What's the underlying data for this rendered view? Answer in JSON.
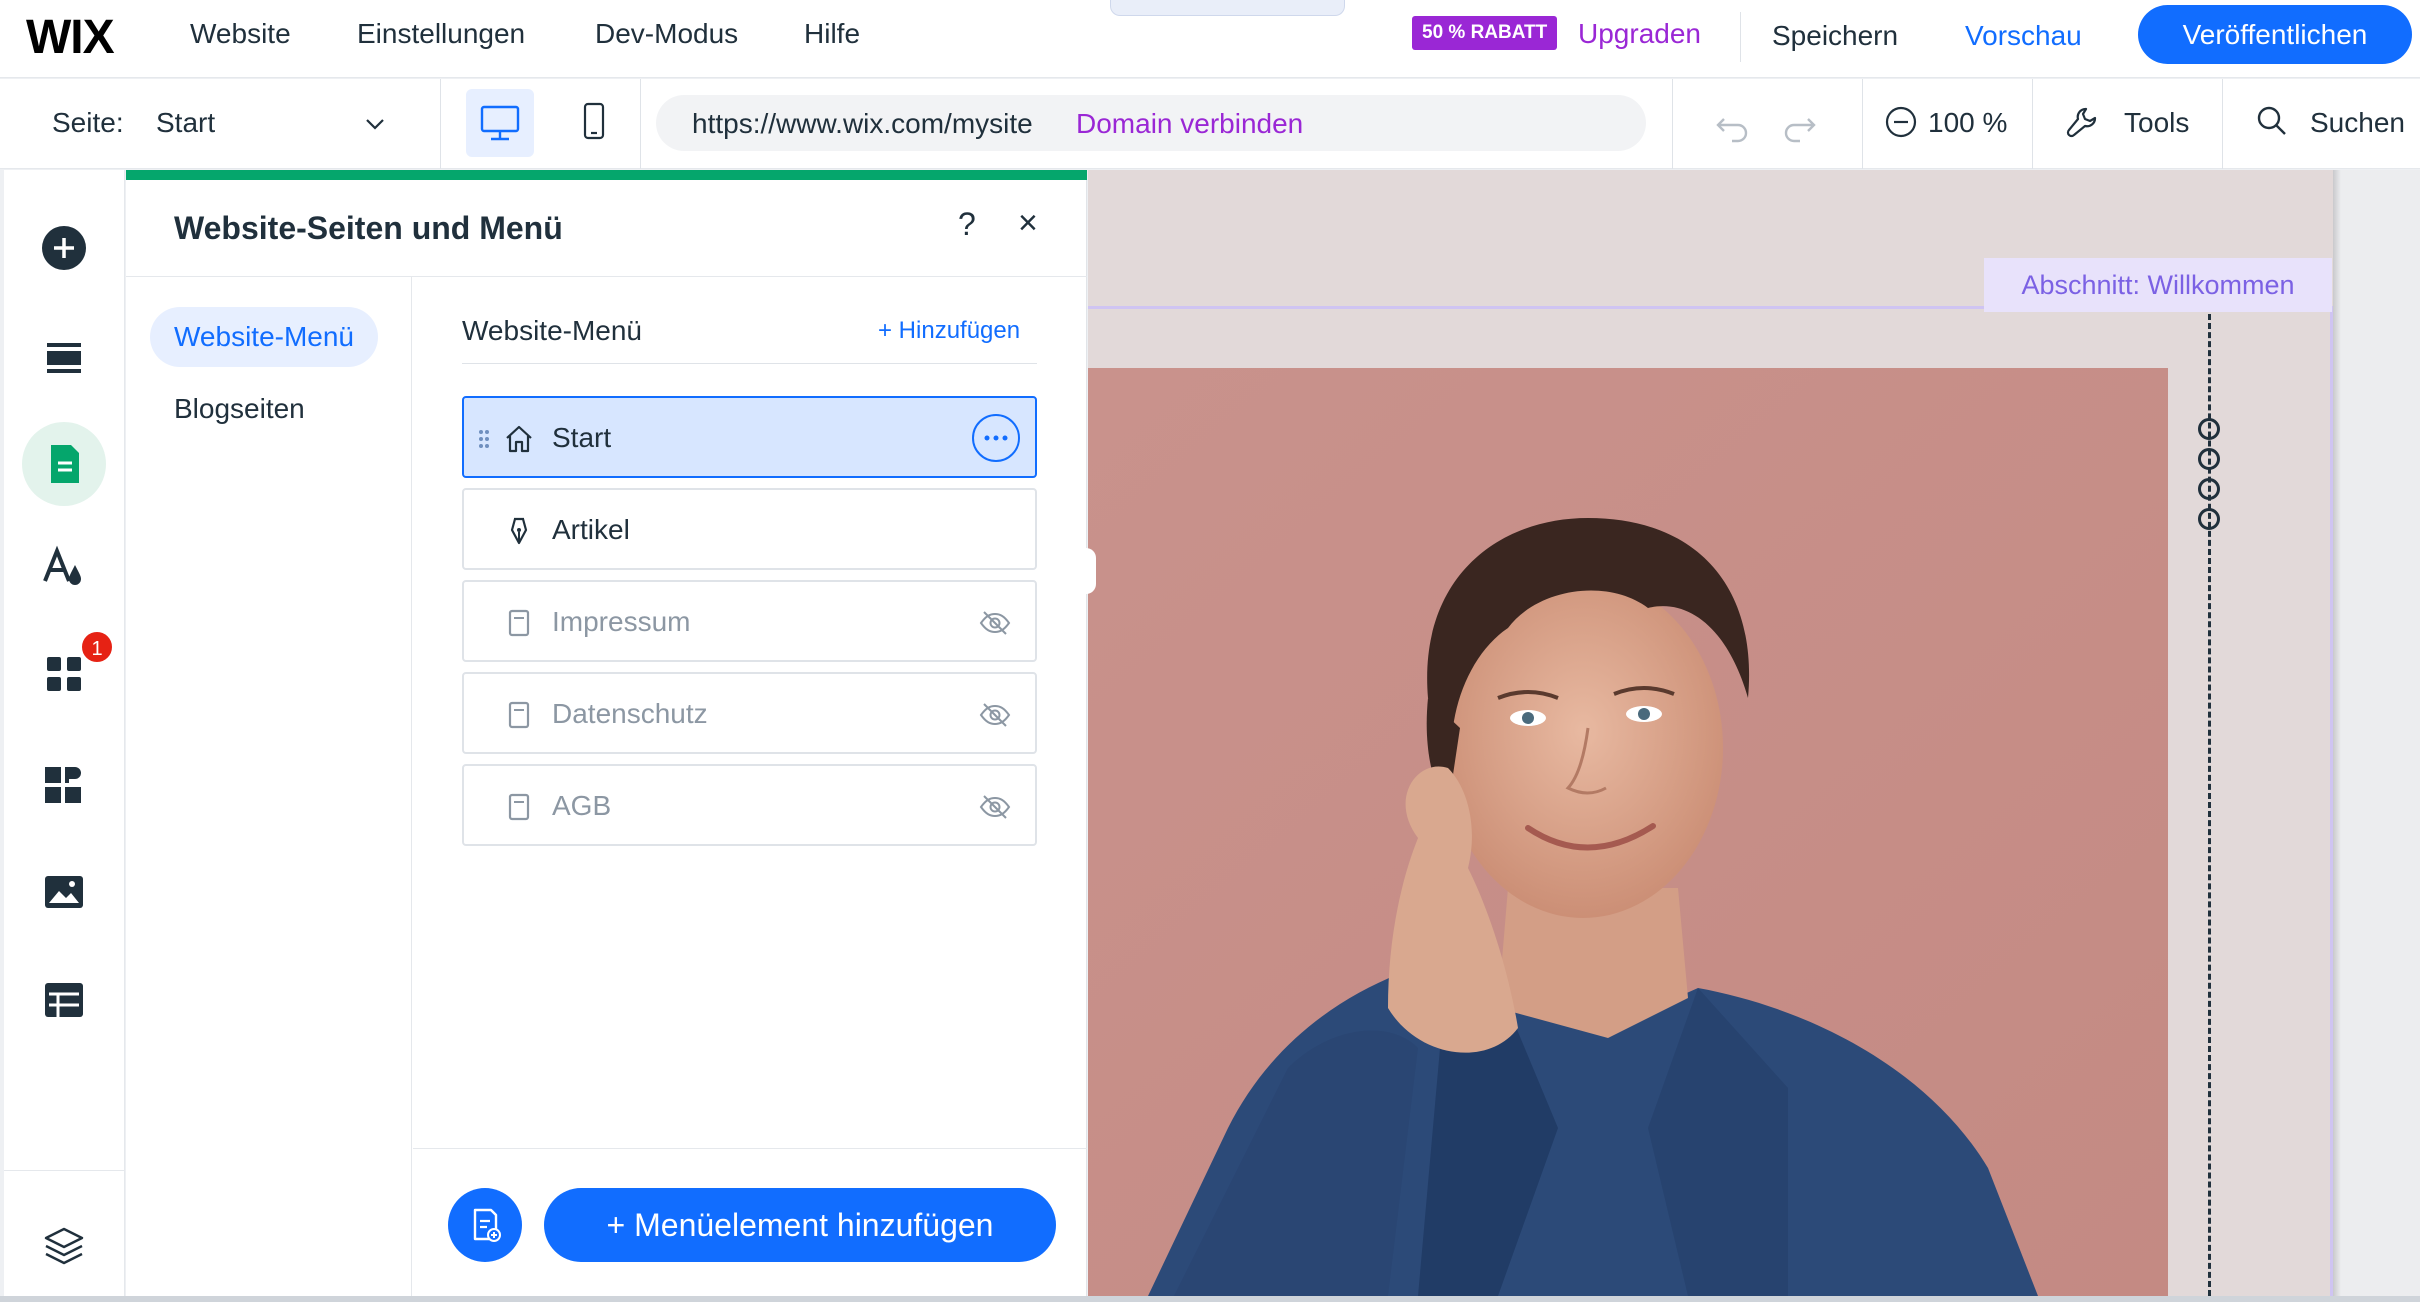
{
  "topbar": {
    "logo": "WIX",
    "nav": [
      "Website",
      "Einstellungen",
      "Dev-Modus",
      "Hilfe"
    ],
    "discount_badge": "50 % RABATT",
    "upgrade": "Upgraden",
    "save": "Speichern",
    "preview": "Vorschau",
    "publish": "Veröffentlichen"
  },
  "secondbar": {
    "page_label": "Seite:",
    "page_value": "Start",
    "url": "https://www.wix.com/mysite",
    "connect_domain": "Domain verbinden",
    "zoom": "100 %",
    "tools": "Tools",
    "search": "Suchen"
  },
  "lefttoolbar": {
    "notification_count": "1",
    "icons": [
      "add-elements-icon",
      "sections-icon",
      "pages-icon",
      "theme-icon",
      "apps-icon",
      "business-apps-icon",
      "media-icon",
      "cms-icon",
      "layers-icon"
    ]
  },
  "panel": {
    "title": "Website-Seiten und Menü",
    "help": "?",
    "close": "×",
    "tabs": [
      {
        "label": "Website-Menü",
        "active": true
      },
      {
        "label": "Blogseiten",
        "active": false
      }
    ],
    "menu_header": "Website-Menü",
    "menu_add": "+ Hinzufügen",
    "items": [
      {
        "label": "Start",
        "icon": "home-icon",
        "hidden": false,
        "selected": true
      },
      {
        "label": "Artikel",
        "icon": "pen-nib-icon",
        "hidden": false,
        "selected": false
      },
      {
        "label": "Impressum",
        "icon": "page-icon",
        "hidden": true,
        "selected": false
      },
      {
        "label": "Datenschutz",
        "icon": "page-icon",
        "hidden": true,
        "selected": false
      },
      {
        "label": "AGB",
        "icon": "page-icon",
        "hidden": true,
        "selected": false
      }
    ],
    "add_menu_item": "+  Menüelement hinzufügen"
  },
  "canvas": {
    "section_label": "Abschnitt: Willkommen"
  },
  "colors": {
    "accent": "#116dff",
    "premium": "#9a27d5",
    "panel_top": "#05a66c",
    "section": "#7b61e4"
  }
}
